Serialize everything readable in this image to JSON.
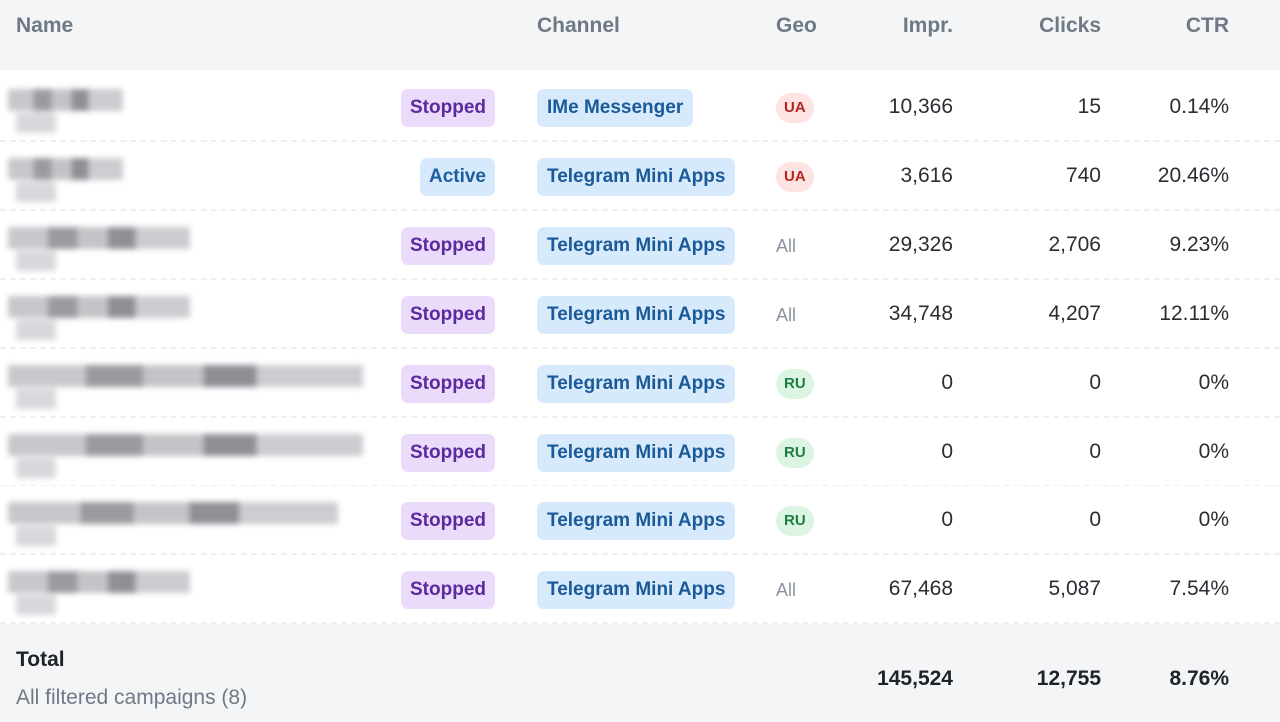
{
  "table": {
    "columns": {
      "name": "Name",
      "channel": "Channel",
      "geo": "Geo",
      "impr": "Impr.",
      "clicks": "Clicks",
      "ctr": "CTR"
    },
    "rows": [
      {
        "status": "Stopped",
        "channel": "IMe Messenger",
        "geo": "UA",
        "impr": "10,366",
        "clicks": "15",
        "ctr": "0.14%"
      },
      {
        "status": "Active",
        "channel": "Telegram Mini Apps",
        "geo": "UA",
        "impr": "3,616",
        "clicks": "740",
        "ctr": "20.46%"
      },
      {
        "status": "Stopped",
        "channel": "Telegram Mini Apps",
        "geo": "All",
        "impr": "29,326",
        "clicks": "2,706",
        "ctr": "9.23%"
      },
      {
        "status": "Stopped",
        "channel": "Telegram Mini Apps",
        "geo": "All",
        "impr": "34,748",
        "clicks": "4,207",
        "ctr": "12.11%"
      },
      {
        "status": "Stopped",
        "channel": "Telegram Mini Apps",
        "geo": "RU",
        "impr": "0",
        "clicks": "0",
        "ctr": "0%"
      },
      {
        "status": "Stopped",
        "channel": "Telegram Mini Apps",
        "geo": "RU",
        "impr": "0",
        "clicks": "0",
        "ctr": "0%"
      },
      {
        "status": "Stopped",
        "channel": "Telegram Mini Apps",
        "geo": "RU",
        "impr": "0",
        "clicks": "0",
        "ctr": "0%"
      },
      {
        "status": "Stopped",
        "channel": "Telegram Mini Apps",
        "geo": "All",
        "impr": "67,468",
        "clicks": "5,087",
        "ctr": "7.54%"
      }
    ],
    "total": {
      "label": "Total",
      "sublabel": "All filtered campaigns (8)",
      "impr": "145,524",
      "clicks": "12,755",
      "ctr": "8.76%"
    }
  },
  "colors": {
    "stopped_bg": "#eadbfb",
    "stopped_text": "#5a2a9e",
    "active_bg": "#d7eafb",
    "channel_bg": "#d7eafb",
    "geo_ua": "#b3261e",
    "geo_ru": "#1e7d43"
  }
}
